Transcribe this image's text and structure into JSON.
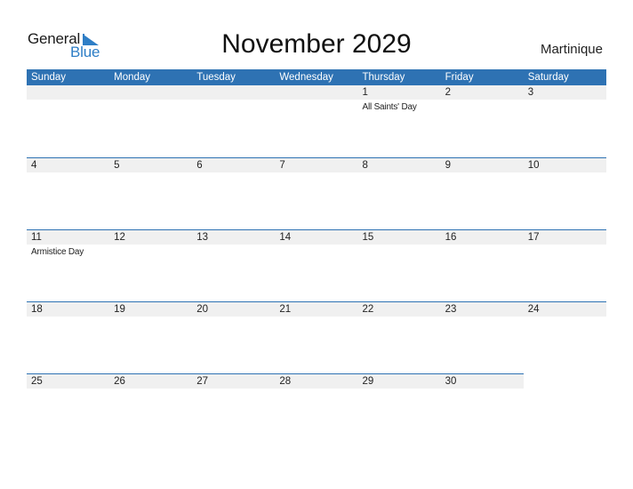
{
  "logo": {
    "line1": "General",
    "line2": "Blue",
    "icon": "blue-triangle-flag-icon"
  },
  "header": {
    "title": "November 2029",
    "country": "Martinique"
  },
  "colors": {
    "accent": "#2e72b3",
    "band": "#f0f0f0",
    "logo_blue": "#2e7ec6"
  },
  "weekdays": [
    "Sunday",
    "Monday",
    "Tuesday",
    "Wednesday",
    "Thursday",
    "Friday",
    "Saturday"
  ],
  "weeks": [
    [
      {
        "day": ""
      },
      {
        "day": ""
      },
      {
        "day": ""
      },
      {
        "day": ""
      },
      {
        "day": "1",
        "event": "All Saints' Day"
      },
      {
        "day": "2"
      },
      {
        "day": "3"
      }
    ],
    [
      {
        "day": "4"
      },
      {
        "day": "5"
      },
      {
        "day": "6"
      },
      {
        "day": "7"
      },
      {
        "day": "8"
      },
      {
        "day": "9"
      },
      {
        "day": "10"
      }
    ],
    [
      {
        "day": "11",
        "event": "Armistice Day"
      },
      {
        "day": "12"
      },
      {
        "day": "13"
      },
      {
        "day": "14"
      },
      {
        "day": "15"
      },
      {
        "day": "16"
      },
      {
        "day": "17"
      }
    ],
    [
      {
        "day": "18"
      },
      {
        "day": "19"
      },
      {
        "day": "20"
      },
      {
        "day": "21"
      },
      {
        "day": "22"
      },
      {
        "day": "23"
      },
      {
        "day": "24"
      }
    ],
    [
      {
        "day": "25"
      },
      {
        "day": "26"
      },
      {
        "day": "27"
      },
      {
        "day": "28"
      },
      {
        "day": "29"
      },
      {
        "day": "30"
      },
      null
    ]
  ]
}
